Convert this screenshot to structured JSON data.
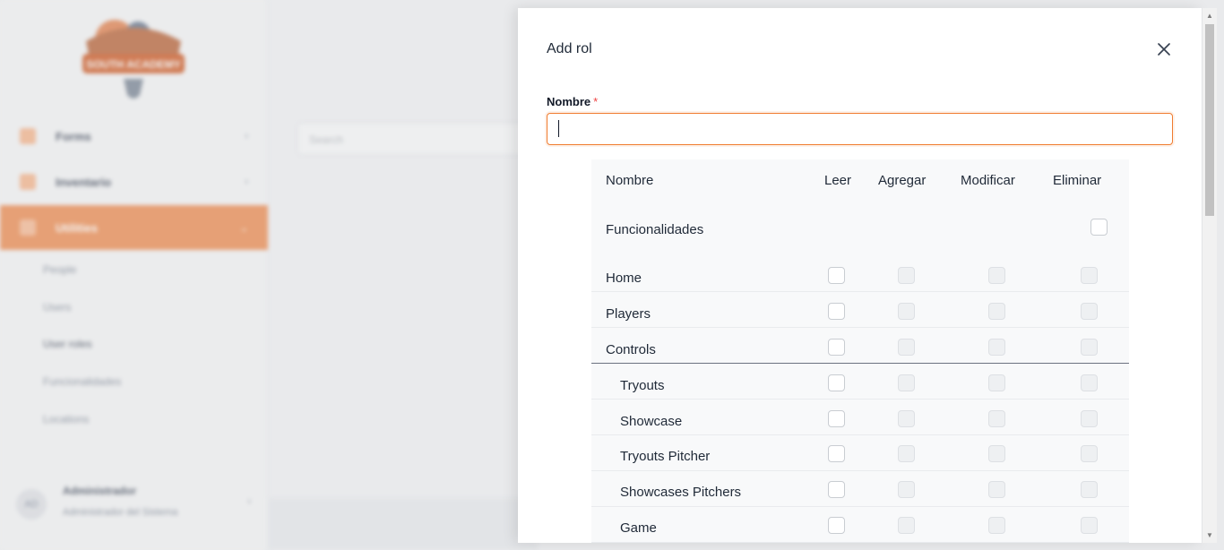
{
  "background": {
    "logo_text": "SOUTH ACADEMY",
    "nav": [
      {
        "label": "Forms",
        "chevron": "›"
      },
      {
        "label": "Inventario",
        "chevron": "›"
      },
      {
        "label": "Utilities",
        "chevron": "⌄"
      }
    ],
    "sub_items": [
      "People",
      "Users",
      "User roles",
      "Funcionalidades",
      "Locations"
    ],
    "search_placeholder": "Search",
    "user": {
      "initials": "AD",
      "name": "Administrador",
      "role": "Administrador del Sistema",
      "chevron": "›"
    }
  },
  "drawer": {
    "title": "Add rol",
    "name_label": "Nombre",
    "required_mark": "*",
    "name_value": "",
    "table": {
      "headers": {
        "name": "Nombre",
        "read": "Leer",
        "add": "Agregar",
        "modify": "Modificar",
        "delete": "Eliminar"
      },
      "select_all_row": "Funcionalidades",
      "rows": [
        {
          "name": "Home"
        },
        {
          "name": "Players"
        },
        {
          "name": "Controls"
        },
        {
          "name": "Tryouts"
        },
        {
          "name": "Showcase"
        },
        {
          "name": "Tryouts Pitcher"
        },
        {
          "name": "Showcases Pitchers"
        },
        {
          "name": "Game"
        }
      ]
    }
  },
  "colors": {
    "accent": "#f07b2e",
    "active_nav": "#f0a77b",
    "required": "#ef4444"
  }
}
